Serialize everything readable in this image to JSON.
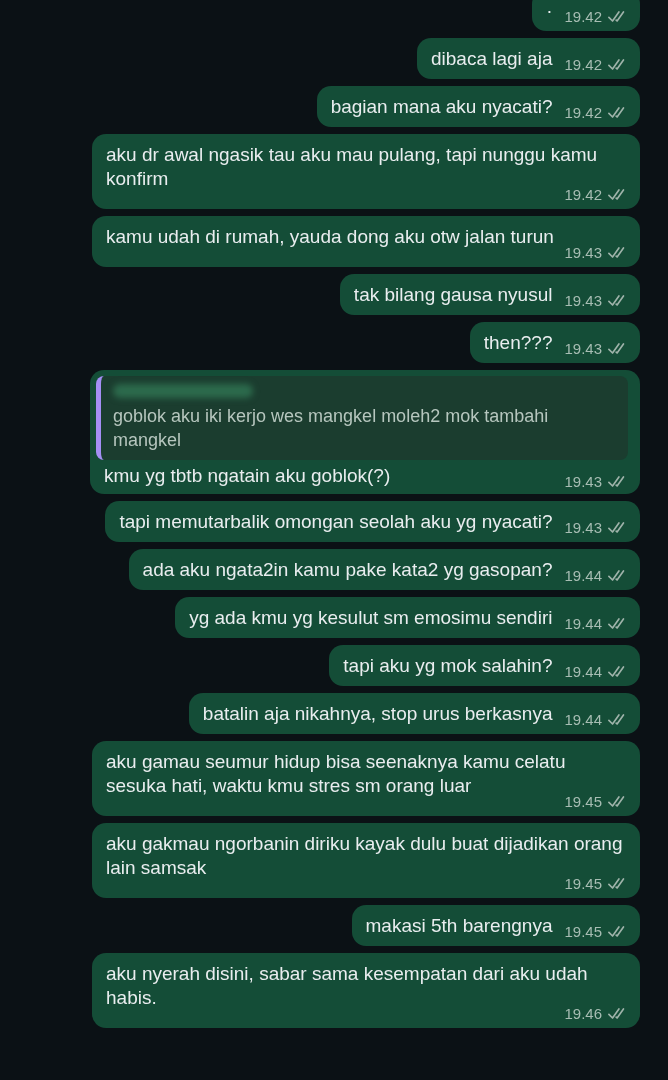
{
  "messages": [
    {
      "text": "·",
      "time": "19.42",
      "read": false
    },
    {
      "text": "dibaca lagi aja",
      "time": "19.42",
      "read": false
    },
    {
      "text": "bagian mana aku nyacati?",
      "time": "19.42",
      "read": false
    },
    {
      "text": "aku dr awal ngasik tau aku mau pulang, tapi nunggu kamu konfirm",
      "time": "19.42",
      "read": false
    },
    {
      "text": "kamu udah di rumah, yauda dong aku otw jalan turun",
      "time": "19.43",
      "read": false
    },
    {
      "text": "tak bilang gausa nyusul",
      "time": "19.43",
      "read": false
    },
    {
      "text": "then???",
      "time": "19.43",
      "read": false
    },
    {
      "text": "kmu yg tbtb ngatain aku goblok(?)",
      "time": "19.43",
      "read": false,
      "quote": {
        "text": "goblok aku iki kerjo wes mangkel moleh2 mok tambahi mangkel"
      }
    },
    {
      "text": "tapi memutarbalik omongan seolah aku yg nyacati?",
      "time": "19.43",
      "read": false
    },
    {
      "text": "ada aku ngata2in kamu pake kata2 yg gasopan?",
      "time": "19.44",
      "read": false
    },
    {
      "text": "yg ada kmu yg kesulut sm emosimu sendiri",
      "time": "19.44",
      "read": false
    },
    {
      "text": "tapi aku yg mok salahin?",
      "time": "19.44",
      "read": false
    },
    {
      "text": "batalin aja nikahnya, stop urus berkasnya",
      "time": "19.44",
      "read": false
    },
    {
      "text": "aku gamau seumur hidup bisa seenaknya kamu celatu sesuka hati, waktu kmu stres sm orang luar",
      "time": "19.45",
      "read": false
    },
    {
      "text": "aku gakmau ngorbanin diriku kayak dulu buat dijadikan orang lain samsak",
      "time": "19.45",
      "read": false
    },
    {
      "text": "makasi 5th barengnya",
      "time": "19.45",
      "read": false
    },
    {
      "text": "aku nyerah disini, sabar sama kesempatan dari aku udah habis.",
      "time": "19.46",
      "read": false
    }
  ]
}
